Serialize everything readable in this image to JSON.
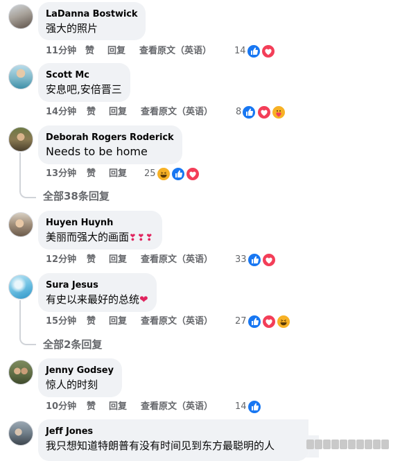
{
  "labels": {
    "like": "赞",
    "reply": "回复",
    "see_original": "查看原文（英语）"
  },
  "colors": {
    "like_blue": "#1877f2",
    "love_red": "#f33e58",
    "haha_yellow": "#f7b125",
    "meta_gray": "#65676b",
    "bubble_bg": "#f0f2f5"
  },
  "comments": [
    {
      "author": "LaDanna Bostwick",
      "text": "强大的照片",
      "time": "11分钟",
      "reactions_count": "14",
      "reactions": [
        "like-icon",
        "love-icon"
      ],
      "show_see_original": true
    },
    {
      "author": "Scott Mc",
      "text": "安息吧,安倍晋三",
      "time": "14分钟",
      "reactions_count": "8",
      "reactions": [
        "like-icon",
        "love-icon",
        "care-icon"
      ],
      "show_see_original": true
    },
    {
      "author": "Deborah Rogers Roderick",
      "text": "Needs to be home",
      "time": "13分钟",
      "reactions_count": "25",
      "reactions": [
        "haha-icon",
        "like-icon",
        "love-icon"
      ],
      "show_see_original": false,
      "replies_link": "全部38条回复"
    },
    {
      "author": "Huyen Huynh",
      "text": "美丽而强大的画面",
      "text_emoji": "❣❣❣",
      "time": "12分钟",
      "reactions_count": "33",
      "reactions": [
        "like-icon",
        "love-icon"
      ],
      "show_see_original": true
    },
    {
      "author": "Sura Jesus",
      "text": "有史以来最好的总统",
      "text_emoji": "❤",
      "time": "15分钟",
      "reactions_count": "27",
      "reactions": [
        "like-icon",
        "love-icon",
        "haha-icon"
      ],
      "show_see_original": true,
      "replies_link": "全部2条回复"
    },
    {
      "author": "Jenny Godsey",
      "text": "惊人的时刻",
      "time": "10分钟",
      "reactions_count": "14",
      "reactions": [
        "like-icon"
      ],
      "show_see_original": true
    },
    {
      "author": "Jeff Jones",
      "text": "我只想知道特朗普有没有时间见到东方最聪明的人",
      "show_see_original": false
    }
  ]
}
